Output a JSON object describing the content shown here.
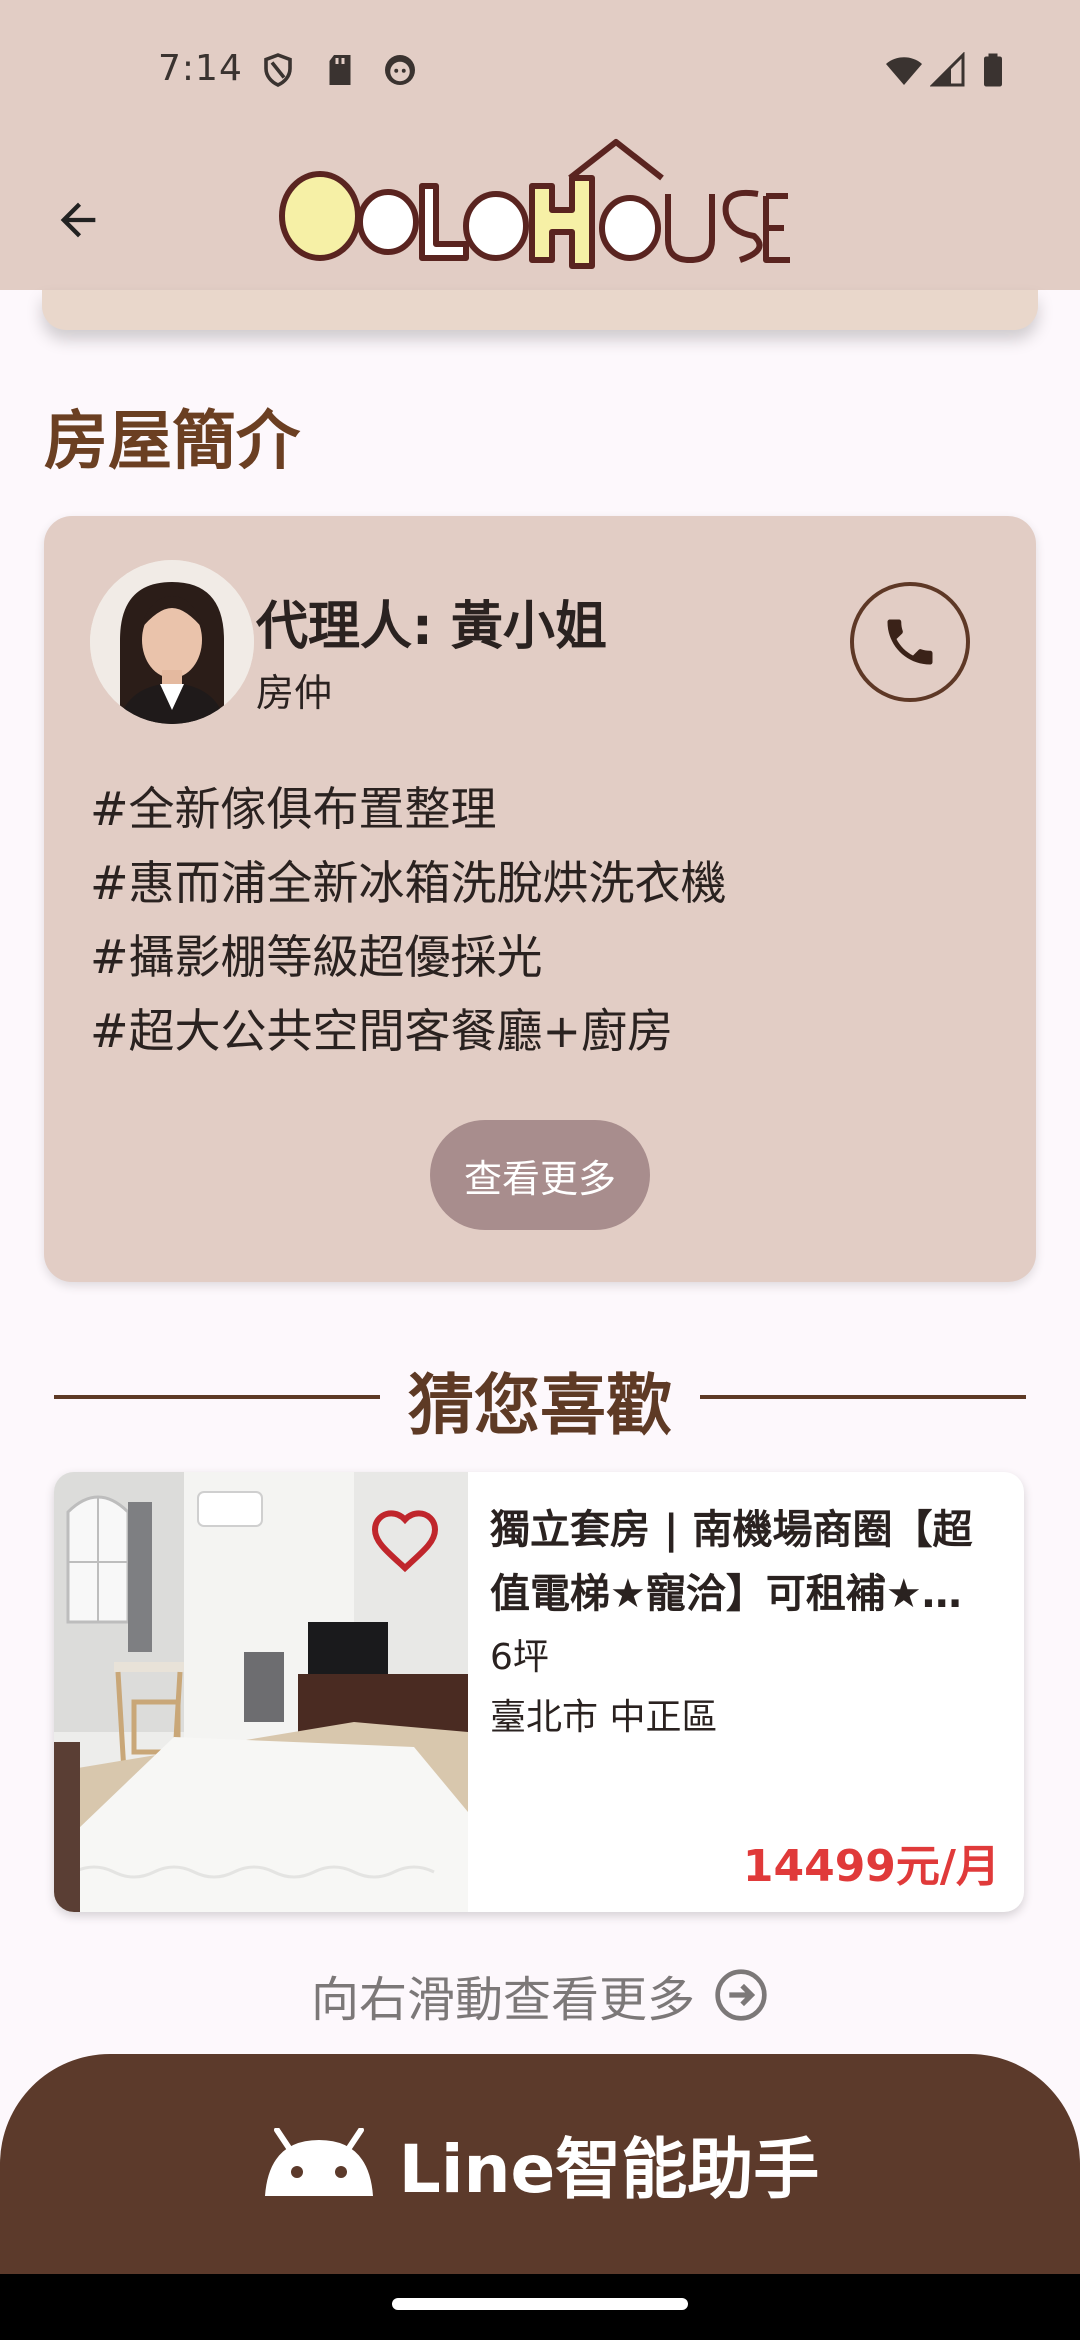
{
  "status_bar": {
    "time": "7:14"
  },
  "header": {
    "logo_text": "GOLD HOUSE"
  },
  "intro": {
    "title": "房屋簡介",
    "agent": {
      "name": "代理人: 黃小姐",
      "role": "房仲"
    },
    "description": [
      "#全新傢俱布置整理",
      "#惠而浦全新冰箱洗脫烘洗衣機",
      "#攝影棚等級超優採光",
      "#超大公共空間客餐廳+廚房"
    ],
    "more_label": "查看更多"
  },
  "recommend": {
    "title": "猜您喜歡",
    "listing": {
      "title": "獨立套房 | 南機場商圈【超值電梯★寵洽】可租補★近捷運",
      "size": "6坪",
      "location": "臺北市 中正區",
      "price": "14499元/月"
    },
    "swipe_hint": "向右滑動查看更多"
  },
  "bottom": {
    "line_label": "Line智能助手"
  },
  "colors": {
    "header_bg": "#e2cdc5",
    "brown": "#5e3a25",
    "price_red": "#e03a3a",
    "button_mauve": "#a88d8d"
  }
}
